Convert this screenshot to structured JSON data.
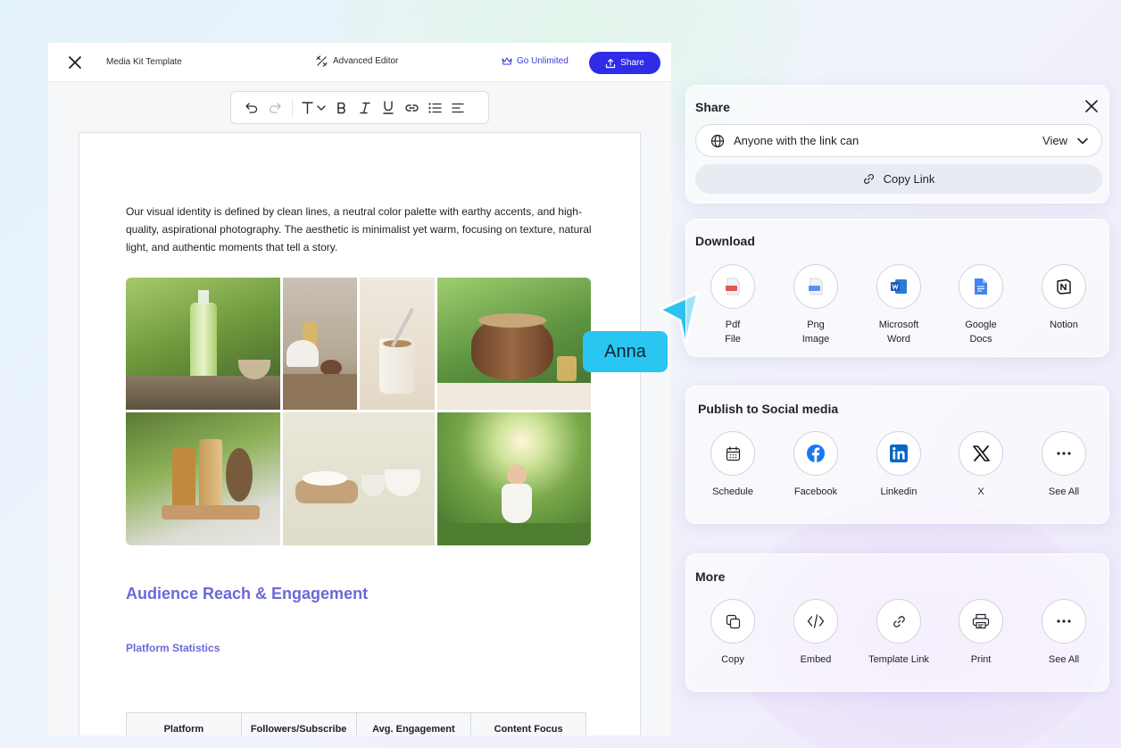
{
  "editor": {
    "title": "Media Kit Template",
    "advanced_label": "Advanced Editor",
    "go_unlimited_label": "Go Unlimited",
    "share_label": "Share",
    "intro_text": "Our visual identity is defined by clean lines, a neutral color palette with earthy accents, and high-quality, aspirational photography. The aesthetic is minimalist yet warm, focusing on texture, natural light, and authentic moments that tell a story.",
    "heading": "Audience Reach & Engagement",
    "subheading": "Platform Statistics",
    "table_headers": [
      "Platform",
      "Followers/Subscribe",
      "Avg. Engagement",
      "Content Focus"
    ],
    "toolbar_icons": [
      "undo-icon",
      "redo-icon",
      "text-style-icon",
      "bold-icon",
      "italic-icon",
      "underline-icon",
      "link-icon",
      "bullet-list-icon",
      "align-icon"
    ]
  },
  "cursor": {
    "name": "Anna",
    "color": "#2ac6f2"
  },
  "share_panel": {
    "title": "Share",
    "access_text": "Anyone with the link can",
    "access_level": "View",
    "copy_link": "Copy Link"
  },
  "download": {
    "title": "Download",
    "items": [
      {
        "line1": "Pdf",
        "line2": "File"
      },
      {
        "line1": "Png",
        "line2": "Image"
      },
      {
        "line1": "Microsoft",
        "line2": "Word"
      },
      {
        "line1": "Google",
        "line2": "Docs"
      },
      {
        "line1": "Notion",
        "line2": ""
      }
    ]
  },
  "social": {
    "title": "Publish to Social media",
    "items": [
      "Schedule",
      "Facebook",
      "Linkedin",
      "X",
      "See All"
    ]
  },
  "more": {
    "title": "More",
    "items": [
      "Copy",
      "Embed",
      "Template Link",
      "Print",
      "See All"
    ]
  },
  "colors": {
    "primary": "#2f2ce8",
    "heading": "#6c68d8",
    "cursor": "#2ac6f2"
  }
}
